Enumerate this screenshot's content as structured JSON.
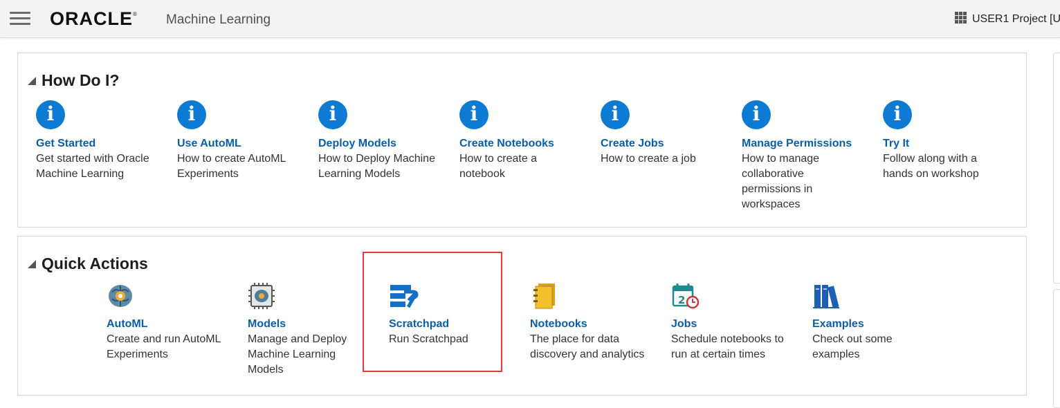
{
  "header": {
    "logo": "ORACLE",
    "product": "Machine Learning",
    "project": "USER1 Project [U"
  },
  "how_do_i": {
    "title": "How Do I?",
    "items": [
      {
        "title": "Get Started",
        "desc": "Get started with Oracle Machine Learning",
        "icon": "info-icon"
      },
      {
        "title": "Use AutoML",
        "desc": "How to create AutoML Experiments",
        "icon": "info-icon"
      },
      {
        "title": "Deploy Models",
        "desc": "How to Deploy Machine Learning Models",
        "icon": "info-icon"
      },
      {
        "title": "Create Notebooks",
        "desc": "How to create a notebook",
        "icon": "info-icon"
      },
      {
        "title": "Create Jobs",
        "desc": "How to create a job",
        "icon": "info-icon"
      },
      {
        "title": "Manage Permissions",
        "desc": "How to manage collaborative permissions in workspaces",
        "icon": "info-icon"
      },
      {
        "title": "Try It",
        "desc": "Follow along with a hands on workshop",
        "icon": "info-icon"
      }
    ]
  },
  "quick_actions": {
    "title": "Quick Actions",
    "items": [
      {
        "title": "AutoML",
        "desc": "Create and run AutoML Experiments",
        "icon": "automl-brain-icon"
      },
      {
        "title": "Models",
        "desc": "Manage and Deploy Machine Learning Models",
        "icon": "models-chip-icon"
      },
      {
        "title": "Scratchpad",
        "desc": "Run Scratchpad",
        "icon": "scratchpad-icon"
      },
      {
        "title": "Notebooks",
        "desc": "The place for data discovery and analytics",
        "icon": "notebooks-icon"
      },
      {
        "title": "Jobs",
        "desc": "Schedule notebooks to run at certain times",
        "icon": "jobs-calendar-icon"
      },
      {
        "title": "Examples",
        "desc": "Check out some examples",
        "icon": "examples-books-icon"
      }
    ]
  },
  "colors": {
    "link": "#0a5ea8",
    "info": "#0d7bd3",
    "highlight": "#e13b3b"
  }
}
